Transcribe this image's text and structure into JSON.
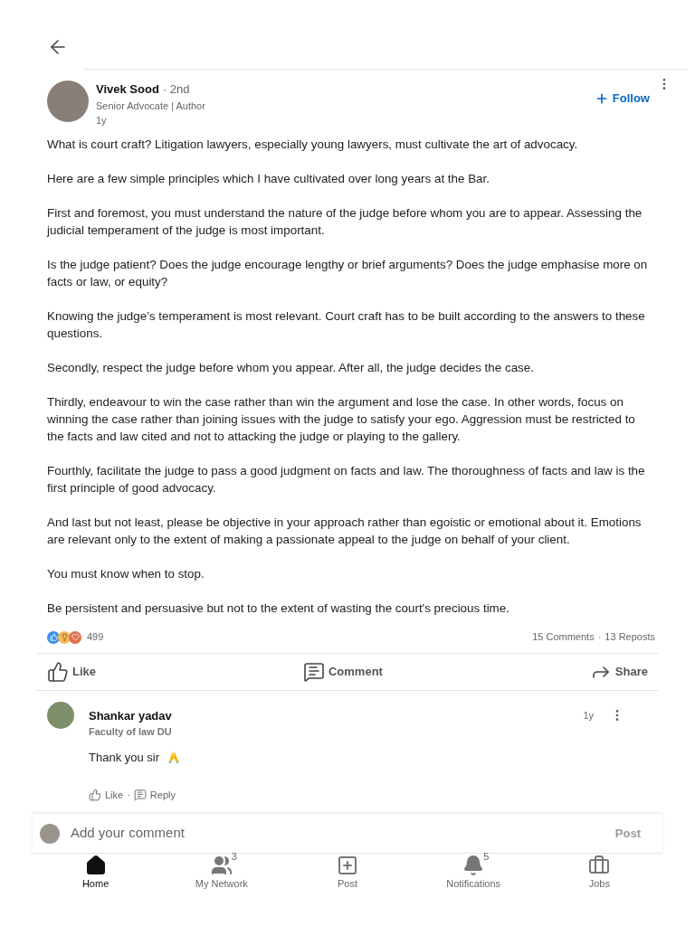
{
  "author": {
    "name": "Vivek Sood",
    "degree": "· 2nd",
    "headline": "Senior Advocate | Author",
    "time": "1y",
    "follow": "Follow"
  },
  "paragraphs": [
    "What is court craft? Litigation lawyers, especially young lawyers, must cultivate the art of advocacy.",
    "Here are a few simple principles which I have cultivated over long years at the Bar.",
    "First and foremost, you must understand the nature of the judge before whom you are to appear. Assessing the judicial temperament of the judge is most important.",
    "Is the judge patient? Does the judge encourage lengthy or brief arguments? Does the judge emphasise more on facts or law, or equity?",
    "Knowing the judge’s temperament is most relevant. Court craft has to be built according to the answers to these questions.",
    "Secondly, respect the judge before whom you appear. After all, the judge decides the case.",
    "Thirdly, endeavour to win the case rather than win the argument and lose the case. In other words, focus on winning the case rather than joining issues with the judge to satisfy your ego. Aggression must be restricted to the facts and law cited and not to attacking the judge or playing to the gallery.",
    "Fourthly, facilitate the judge to pass a good judgment on facts and law. The thoroughness of facts and law is the first principle of good advocacy.",
    "And last but not least, please be objective in your approach rather than egoistic or emotional about it. Emotions are relevant only to the extent of making a passionate appeal to the judge on behalf of your client.",
    "You must know when to stop.",
    "Be persistent and persuasive but not to the extent of wasting the court's precious time."
  ],
  "stats": {
    "reactions": "499",
    "comments": "15 Comments",
    "separator": "·",
    "reposts": "13 Reposts"
  },
  "actions": [
    {
      "kind": "like",
      "label": "Like"
    },
    {
      "kind": "comment",
      "label": "Comment"
    },
    {
      "kind": "share",
      "label": "Share"
    }
  ],
  "comments": [
    {
      "name": "Shankar yadav",
      "headline": "Faculty of law DU",
      "time": "1y",
      "text": "Thank you sir",
      "like": "Like",
      "separator": "·",
      "reply": "Reply"
    }
  ],
  "composer": {
    "placeholder": "Add your comment",
    "post": "Post"
  },
  "nav": [
    {
      "kind": "home",
      "label": "Home",
      "selected": true
    },
    {
      "kind": "network",
      "label": "My Network",
      "selected": false,
      "badge": "3"
    },
    {
      "kind": "post",
      "label": "Post",
      "selected": false
    },
    {
      "kind": "bell",
      "label": "Notifications",
      "selected": false,
      "badge": "5"
    },
    {
      "kind": "jobs",
      "label": "Jobs",
      "selected": false
    }
  ]
}
